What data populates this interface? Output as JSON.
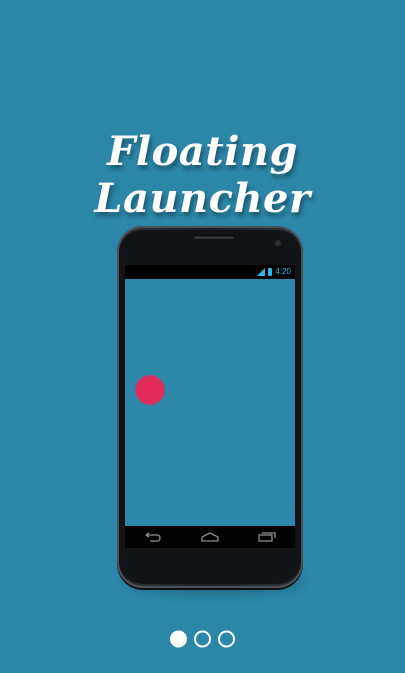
{
  "app": {
    "title": "Floating Launcher"
  },
  "phone": {
    "status_bar": {
      "time": "4:20",
      "icons": [
        "signal-icon",
        "battery-icon"
      ]
    },
    "nav_bar": {
      "buttons": [
        "back-icon",
        "home-icon",
        "recents-icon"
      ]
    },
    "floating_bubble": {
      "color": "#e02a5a"
    }
  },
  "pager": {
    "page_count": 3,
    "current_page": 1
  },
  "colors": {
    "background": "#2b86a8",
    "accent": "#33b5e5",
    "dot": "#ffffff"
  }
}
